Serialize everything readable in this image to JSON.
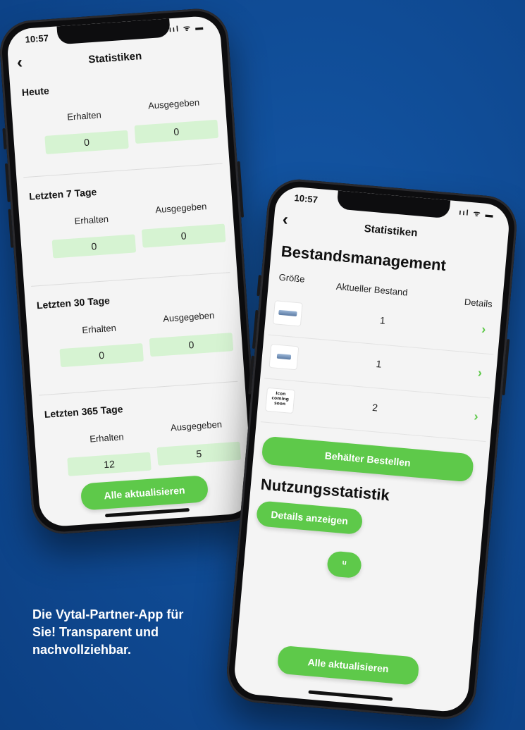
{
  "status_time": "10:57",
  "status_icons": "ııl ᯤ ▬",
  "left_phone": {
    "title": "Statistiken",
    "back": "‹",
    "sections": [
      {
        "label": "Heute",
        "received_label": "Erhalten",
        "spent_label": "Ausgegeben",
        "received": "0",
        "spent": "0"
      },
      {
        "label": "Letzten 7 Tage",
        "received_label": "Erhalten",
        "spent_label": "Ausgegeben",
        "received": "0",
        "spent": "0"
      },
      {
        "label": "Letzten 30 Tage",
        "received_label": "Erhalten",
        "spent_label": "Ausgegeben",
        "received": "0",
        "spent": "0"
      },
      {
        "label": "Letzten 365 Tage",
        "received_label": "Erhalten",
        "spent_label": "Ausgegeben",
        "received": "12",
        "spent": "5"
      }
    ],
    "refresh_button": "Alle aktualisieren"
  },
  "right_phone": {
    "title": "Statistiken",
    "back": "‹",
    "stock_heading": "Bestandsmanagement",
    "columns": {
      "size": "Größe",
      "stock": "Aktueller Bestand",
      "details": "Details"
    },
    "rows": [
      {
        "thumb": "cup-large-icon",
        "stock": "1",
        "chevron": "›"
      },
      {
        "thumb": "cup-small-icon",
        "stock": "1",
        "chevron": "›"
      },
      {
        "thumb_text": "Icon coming soon",
        "stock": "2",
        "chevron": "›"
      }
    ],
    "order_button": "Behälter Bestellen",
    "usage_heading": "Nutzungsstatistik",
    "details_button": "Details anzeigen",
    "small_button": "u",
    "refresh_button": "Alle aktualisieren"
  },
  "tagline": "Die Vytal-Partner-App für Sie! Transparent und nachvollziehbar.",
  "colors": {
    "background": "#0f4a93",
    "accent_green": "#5ec94a",
    "value_box": "#d6f3d2"
  }
}
